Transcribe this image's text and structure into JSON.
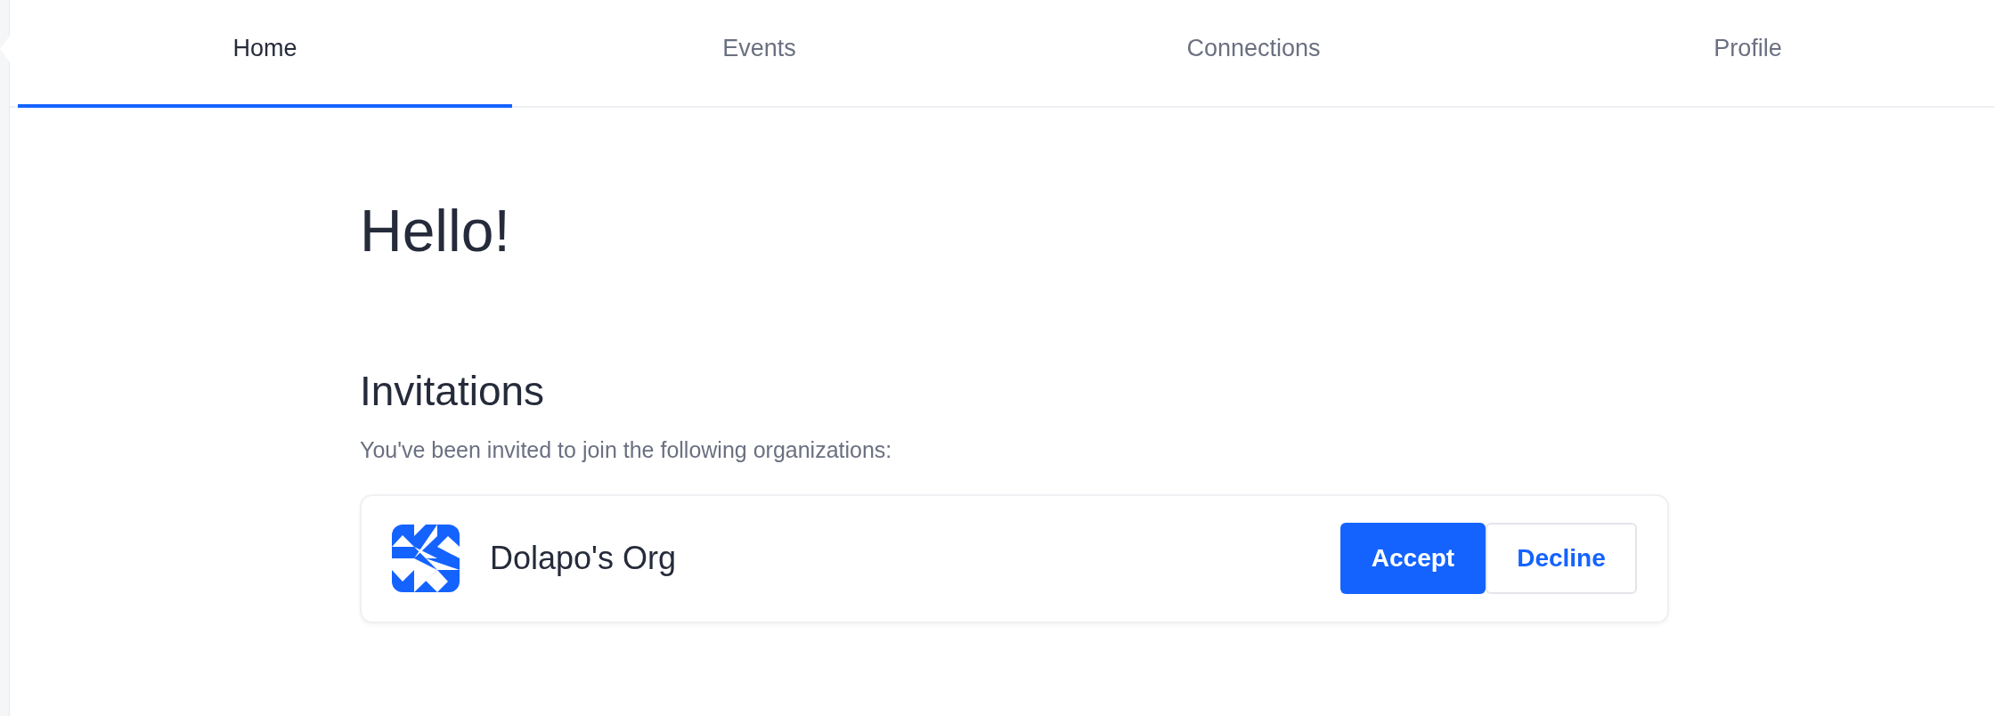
{
  "tabs": [
    {
      "label": "Home",
      "selected": true
    },
    {
      "label": "Events",
      "selected": false
    },
    {
      "label": "Connections",
      "selected": false
    },
    {
      "label": "Profile",
      "selected": false
    }
  ],
  "greeting": "Hello!",
  "invitations": {
    "title": "Invitations",
    "description": "You've been invited to join the following organizations:",
    "items": [
      {
        "name": "Dolapo's Org",
        "accept": "Accept",
        "decline": "Decline"
      }
    ]
  }
}
